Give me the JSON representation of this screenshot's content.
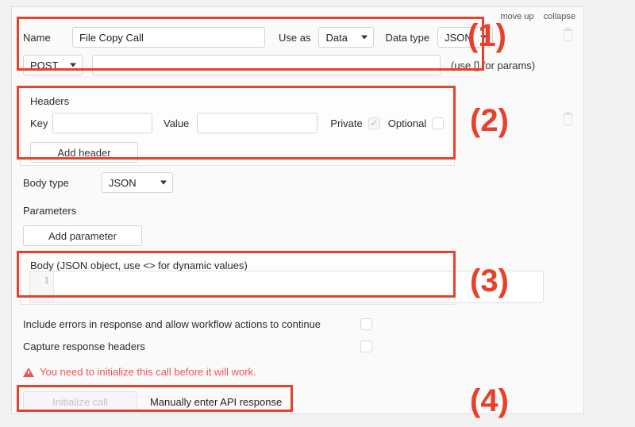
{
  "panel": {
    "utility": {
      "move_up": "move up",
      "collapse": "collapse"
    }
  },
  "api_call": {
    "name_label": "Name",
    "name_value": "File Copy Call",
    "use_as_label": "Use as",
    "use_as_value": "Data",
    "data_type_label": "Data type",
    "data_type_value": "JSON",
    "method_value": "POST",
    "url_value": "",
    "url_placeholder": "",
    "params_hint": "(use [] for params)"
  },
  "headers": {
    "title": "Headers",
    "key_label": "Key",
    "key_value": "",
    "value_label": "Value",
    "value_value": "",
    "private_label": "Private",
    "private_checked": true,
    "optional_label": "Optional",
    "optional_checked": false,
    "add_header_label": "Add header"
  },
  "body_type": {
    "label": "Body type",
    "value": "JSON"
  },
  "parameters": {
    "label": "Parameters",
    "add_parameter_label": "Add parameter"
  },
  "body": {
    "label": "Body (JSON object, use <> for dynamic values)",
    "line_number": "1",
    "content": ""
  },
  "options": {
    "include_errors_label": "Include errors in response and allow workflow actions to continue",
    "include_errors_checked": false,
    "capture_headers_label": "Capture response headers",
    "capture_headers_checked": false
  },
  "warning": {
    "text": "You need to initialize this call before it will work."
  },
  "actions": {
    "initialize_label": "Initialize call",
    "manual_label": "Manually enter API response"
  },
  "annotations": {
    "one": "(1)",
    "two": "(2)",
    "three": "(3)",
    "four": "(4)"
  },
  "colors": {
    "annotation_red": "#e8402a",
    "warning_red": "#ef5350",
    "page_bg": "#f2f2f2",
    "card_bg": "#fafafa"
  }
}
